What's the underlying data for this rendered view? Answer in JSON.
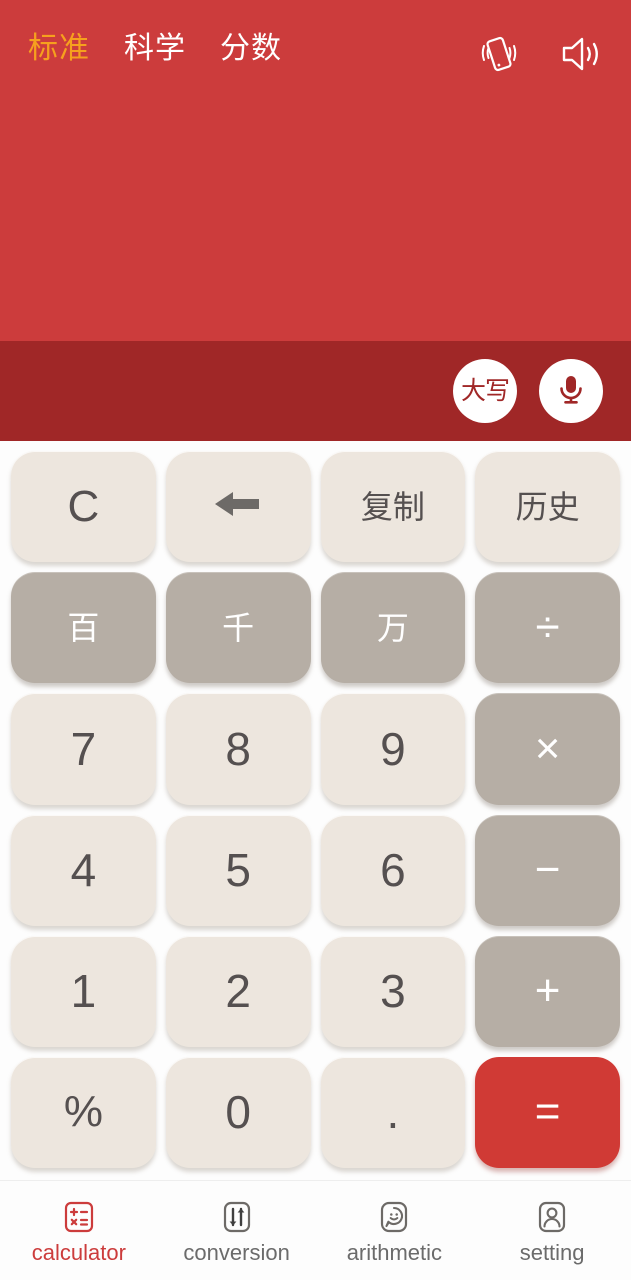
{
  "app": {
    "name": "calculator",
    "accent_color": "#cc3c3c",
    "accent_dark_color": "#a02727",
    "highlight_color": "#f6a01e",
    "key_light_color": "#ede6de",
    "key_dark_color": "#b6aea5",
    "equals_color": "#d03a35"
  },
  "display": {
    "modes": [
      {
        "label": "标准",
        "active": true
      },
      {
        "label": "科学",
        "active": false
      },
      {
        "label": "分数",
        "active": false
      }
    ],
    "icons": [
      {
        "name": "vibrate-icon"
      },
      {
        "name": "sound-icon"
      }
    ],
    "expression": "",
    "result": ""
  },
  "tool_band": {
    "buttons": [
      {
        "name": "uppercase-button",
        "label": "大写",
        "type": "text"
      },
      {
        "name": "microphone-button",
        "label": "",
        "type": "icon"
      }
    ]
  },
  "keypad": {
    "rows": [
      [
        {
          "label": "C",
          "style": "light",
          "kind": "sym",
          "name": "key-clear"
        },
        {
          "label": "",
          "style": "light",
          "kind": "icon",
          "name": "key-backspace"
        },
        {
          "label": "复制",
          "style": "light",
          "kind": "cn",
          "name": "key-copy"
        },
        {
          "label": "历史",
          "style": "light",
          "kind": "cn",
          "name": "key-history"
        }
      ],
      [
        {
          "label": "百",
          "style": "dark",
          "kind": "cn",
          "name": "key-hundred"
        },
        {
          "label": "千",
          "style": "dark",
          "kind": "cn",
          "name": "key-thousand"
        },
        {
          "label": "万",
          "style": "dark",
          "kind": "cn",
          "name": "key-ten-thousand"
        },
        {
          "label": "÷",
          "style": "dark",
          "kind": "op",
          "name": "key-divide"
        }
      ],
      [
        {
          "label": "7",
          "style": "light",
          "kind": "num",
          "name": "key-7"
        },
        {
          "label": "8",
          "style": "light",
          "kind": "num",
          "name": "key-8"
        },
        {
          "label": "9",
          "style": "light",
          "kind": "num",
          "name": "key-9"
        },
        {
          "label": "×",
          "style": "dark",
          "kind": "op",
          "name": "key-multiply"
        }
      ],
      [
        {
          "label": "4",
          "style": "light",
          "kind": "num",
          "name": "key-4"
        },
        {
          "label": "5",
          "style": "light",
          "kind": "num",
          "name": "key-5"
        },
        {
          "label": "6",
          "style": "light",
          "kind": "num",
          "name": "key-6"
        },
        {
          "label": "−",
          "style": "dark",
          "kind": "op",
          "name": "key-minus"
        }
      ],
      [
        {
          "label": "1",
          "style": "light",
          "kind": "num",
          "name": "key-1"
        },
        {
          "label": "2",
          "style": "light",
          "kind": "num",
          "name": "key-2"
        },
        {
          "label": "3",
          "style": "light",
          "kind": "num",
          "name": "key-3"
        },
        {
          "label": "+",
          "style": "dark",
          "kind": "op",
          "name": "key-plus"
        }
      ],
      [
        {
          "label": "%",
          "style": "light",
          "kind": "sym",
          "name": "key-percent"
        },
        {
          "label": "0",
          "style": "light",
          "kind": "num",
          "name": "key-0"
        },
        {
          "label": ".",
          "style": "light",
          "kind": "dot",
          "name": "key-decimal"
        },
        {
          "label": "=",
          "style": "accent",
          "kind": "op",
          "name": "key-equals"
        }
      ]
    ]
  },
  "bottom_nav": {
    "items": [
      {
        "label": "calculator",
        "icon": "calculator-icon",
        "active": true
      },
      {
        "label": "conversion",
        "icon": "conversion-icon",
        "active": false
      },
      {
        "label": "arithmetic",
        "icon": "arithmetic-icon",
        "active": false
      },
      {
        "label": "setting",
        "icon": "person-icon",
        "active": false
      }
    ]
  }
}
